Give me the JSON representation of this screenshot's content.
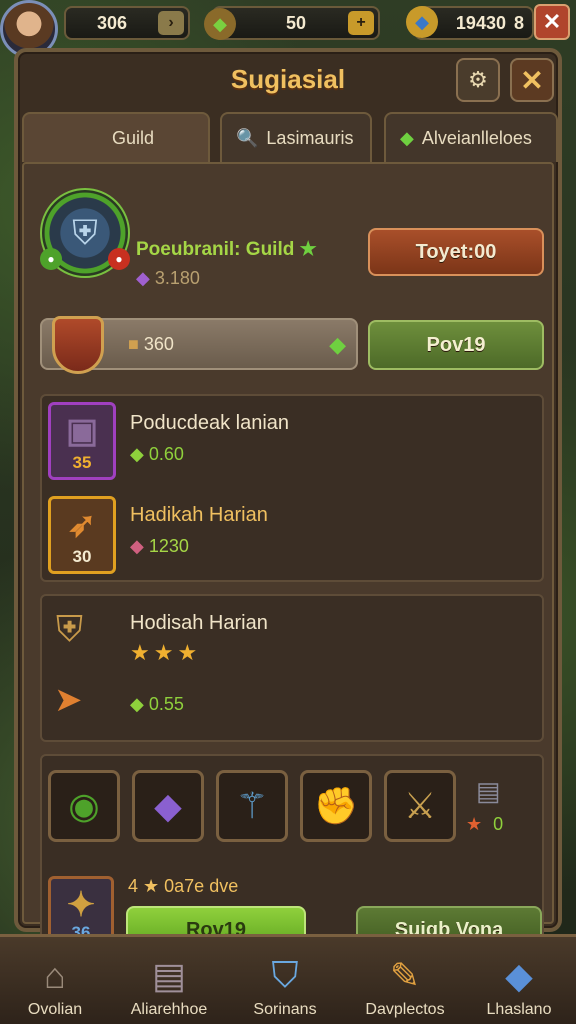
{
  "topbar": {
    "resource_1": "306",
    "resource_2": "50",
    "resource_3": "19430",
    "resource_3_suffix": "8",
    "close_label": "✕"
  },
  "panel": {
    "title": "Sugiasial",
    "close_label": "✕"
  },
  "tabs": [
    {
      "label": "Guild"
    },
    {
      "label": "Lasimauris"
    },
    {
      "label": "Alveianlleloes"
    }
  ],
  "guild": {
    "name": "Poeubranil: Guild",
    "power": "3.180",
    "action_label": "Toyet:00",
    "bar_value": "360",
    "bar_button_label": "Pov19"
  },
  "rewards_card": {
    "items": [
      {
        "title": "Poducdeak lanian",
        "badge": "35",
        "sub": "0.60",
        "sub_color": "#8fd03c"
      },
      {
        "title": "Hadikah Harian",
        "badge": "30",
        "sub": "1230",
        "sub_color": "#a5d646"
      }
    ]
  },
  "daily_card": {
    "title": "Hodisah Harian",
    "reward": "0.55"
  },
  "equipment": {
    "count": "0",
    "featured_badge": "36",
    "featured_label": "4 ★ 0a7e dve",
    "primary_button": "Rov19",
    "secondary_button": "Suigb Vona"
  },
  "bottomnav": [
    {
      "label": "Ovolian",
      "icon": "house-icon"
    },
    {
      "label": "Aliarehhoe",
      "icon": "chest-icon"
    },
    {
      "label": "Sorinans",
      "icon": "shield-icon"
    },
    {
      "label": "Davplectos",
      "icon": "scroll-icon"
    },
    {
      "label": "Lhaslano",
      "icon": "crystal-icon"
    }
  ]
}
